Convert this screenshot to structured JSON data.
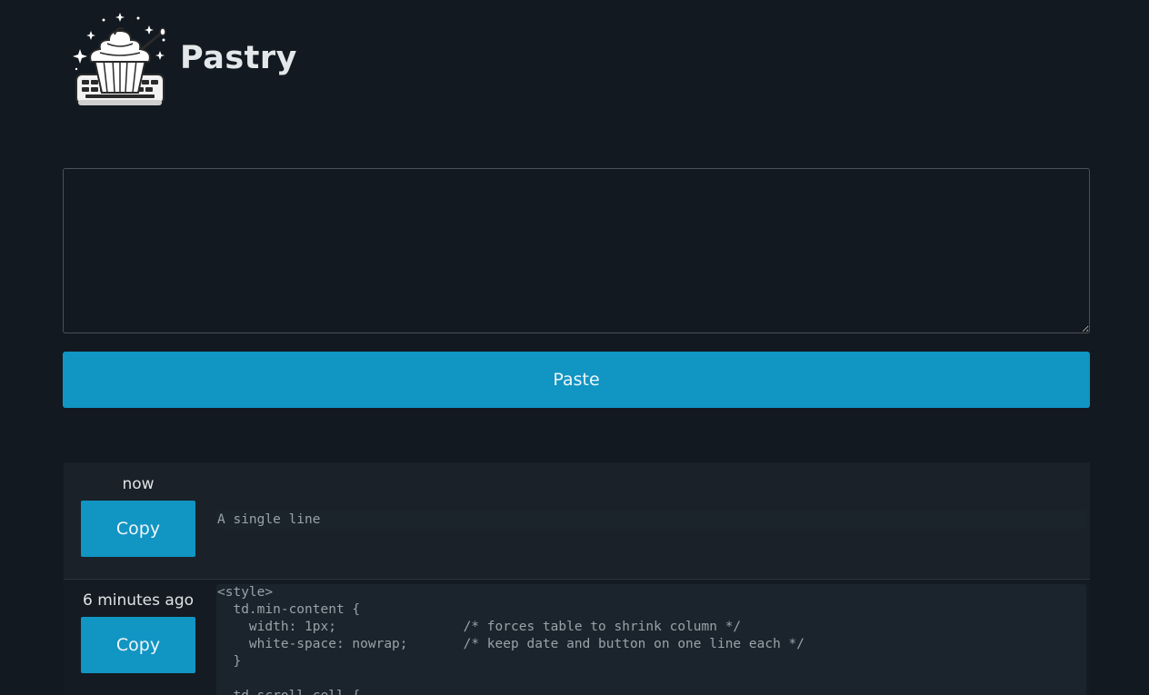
{
  "app": {
    "title": "Pastry",
    "logo_icon": "cupcake-keyboard-logo"
  },
  "editor": {
    "value": "",
    "placeholder": ""
  },
  "paste_button": {
    "label": "Paste"
  },
  "colors": {
    "background": "#121920",
    "accent": "#1195c3",
    "row_background": "#1a2128",
    "code_text": "#9aa2a9"
  },
  "pastes": [
    {
      "timestamp": "now",
      "copy_label": "Copy",
      "content": "A single line"
    },
    {
      "timestamp": "6 minutes ago",
      "copy_label": "Copy",
      "content": "<style>\n  td.min-content {\n    width: 1px;                /* forces table to shrink column */\n    white-space: nowrap;       /* keep date and button on one line each */\n  }\n\n  td.scroll-cell {"
    }
  ]
}
